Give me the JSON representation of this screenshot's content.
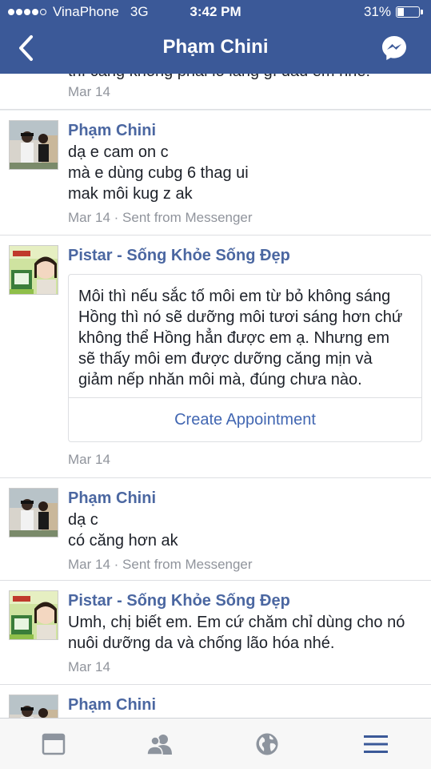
{
  "status_bar": {
    "carrier": "VinaPhone",
    "network": "3G",
    "time": "3:42 PM",
    "battery": "31%",
    "battery_level": 0.31,
    "signal_bars_filled": 4
  },
  "header": {
    "back_icon": "chevron-left-icon",
    "title": "Phạm Chini",
    "messenger_icon": "messenger-icon",
    "bg_color": "#3b5998"
  },
  "messages": [
    {
      "sender": "",
      "lines": [
        "thì căng không phải lo lắng gì đâu em nhé!"
      ],
      "date": "Mar 14",
      "meta_suffix": ""
    },
    {
      "sender": "Phạm Chini",
      "lines": [
        "dạ e cam on c",
        "mà e dùng cubg 6 thag ui",
        "mak môi kug z ak"
      ],
      "date": "Mar 14",
      "meta_suffix": " · Sent from Messenger"
    },
    {
      "sender": "Pistar - Sống Khỏe Sống Đẹp",
      "card_lines": [
        "Môi thì nếu sắc tố môi em từ bỏ không sáng",
        "Hồng thì nó sẽ dưỡng môi tươi sáng hơn chứ",
        "không thể Hồng hẳn được em ạ. Nhưng em",
        "sẽ thấy môi em được dưỡng căng mịn và",
        "giảm nếp nhăn môi mà, đúng chưa nào."
      ],
      "button": "Create Appointment",
      "date": "Mar 14",
      "meta_suffix": ""
    },
    {
      "sender": "Phạm Chini",
      "lines": [
        "dạ c",
        "có căng hơn ak"
      ],
      "date": "Mar 14",
      "meta_suffix": " · Sent from Messenger"
    },
    {
      "sender": "Pistar - Sống Khỏe Sống Đẹp",
      "lines": [
        "Umh, chị biết em. Em cứ chăm chỉ dùng cho nó",
        "nuôi dưỡng da và chống lão hóa nhé."
      ],
      "date": "Mar 14",
      "meta_suffix": ""
    },
    {
      "sender": "Phạm Chini",
      "lines": [],
      "date": "",
      "meta_suffix": ""
    }
  ],
  "tabbar": {
    "tabs": [
      {
        "icon": "news-feed-icon"
      },
      {
        "icon": "friends-icon"
      },
      {
        "icon": "globe-icon"
      },
      {
        "icon": "menu-icon",
        "active": true
      }
    ],
    "active_color": "#3b5998",
    "inactive_color": "#8d949e"
  }
}
